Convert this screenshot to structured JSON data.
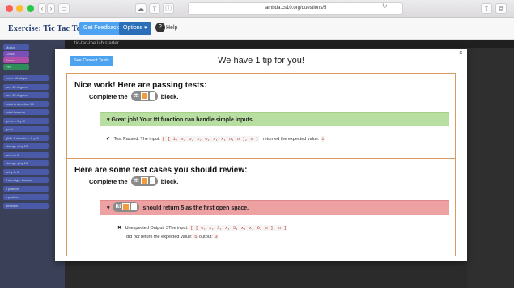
{
  "browser": {
    "url": "lambda.cs10.org/questions/5"
  },
  "header": {
    "exercise_title": "Exercise: Tic Tac Toe",
    "feedback_button": "Get Feedback",
    "options_button": "Options ▾",
    "help_label": "Help"
  },
  "editor": {
    "tab_label": "tic-tac-toe lab starter",
    "palette_items": [
      "Motion",
      "Looks",
      "Sound",
      "Pen",
      "move 10 steps",
      "turn 15 degrees",
      "turn 15 degrees",
      "point in direction 90",
      "point towards",
      "go to x: 0 y: 0",
      "go to",
      "glide 1 secs to x: 0 y: 0",
      "change x by 10",
      "set x to 0",
      "change y by 10",
      "set y to 0",
      "if on edge, bounce",
      "x position",
      "y position",
      "direction"
    ]
  },
  "modal": {
    "see_correct_button": "See Correct Tests",
    "title": "We have 1 tip for you!",
    "close_label": "x",
    "passing": {
      "heading": "Nice work! Here are passing tests:",
      "sub_prefix": "Complete the",
      "sub_suffix": "block.",
      "block_label": "ttt",
      "tip": "▾ Great job! Your ttt function can handle simple inputs.",
      "result_prefix": "Test Passed. The input:",
      "result_input": "[ [ 1, x, o, x, o, x, x, o, o ], x ]",
      "result_middle": ", returned the expected value:",
      "result_value": "1"
    },
    "review": {
      "heading": "Here are some test cases you should review:",
      "sub_prefix": "Complete the",
      "sub_suffix": "block.",
      "block_label": "ttt",
      "tip_arrow": "▾",
      "tip_text": "should return 5 as the first open space.",
      "result_prefix": "Unexpected Output: 3The input:",
      "result_input": "[ [ o, x, 3, x, 5, x, x, 6, o ], o ]",
      "result_line2_a": "did",
      "result_line2_not": "not",
      "result_line2_b": "return the expected value:",
      "expected_value": "5",
      "output_label": "output:",
      "output_value": "3"
    }
  }
}
